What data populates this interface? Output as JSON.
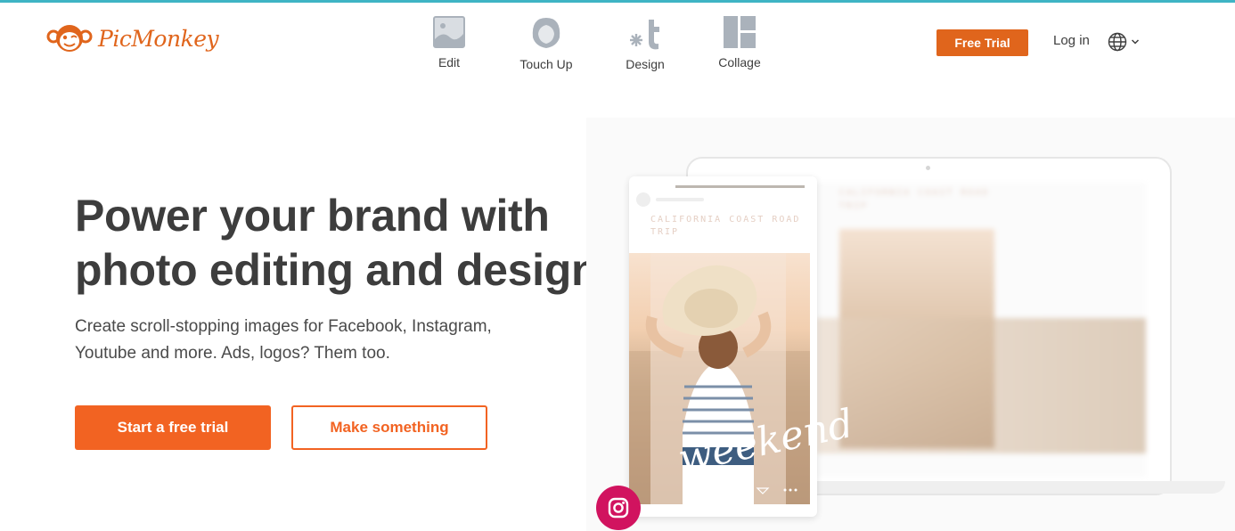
{
  "brand": {
    "name": "PicMonkey",
    "accent": "#e0651c",
    "button_orange": "#f26322",
    "top_line": "#3fb4c4"
  },
  "nav": {
    "items": [
      {
        "label": "Edit",
        "icon": "image-icon"
      },
      {
        "label": "Touch Up",
        "icon": "face-icon"
      },
      {
        "label": "Design",
        "icon": "design-t-icon"
      },
      {
        "label": "Collage",
        "icon": "collage-grid-icon"
      }
    ],
    "free_trial": "Free Trial",
    "login": "Log in",
    "language_icon": "globe-icon"
  },
  "hero": {
    "title": "Power your brand with photo editing and design",
    "subtitle": "Create scroll-stopping images for Facebook, Instagram, Youtube and more. Ads, logos? Them too.",
    "primary_button": "Start a free trial",
    "secondary_button": "Make something"
  },
  "mockup": {
    "phone_caption": "CALIFORNIA COAST ROAD TRIP",
    "laptop_caption": "CALIFORNIA COAST ROAD TRIP",
    "overlay_script": "weekend",
    "social_icon": "instagram-icon"
  }
}
